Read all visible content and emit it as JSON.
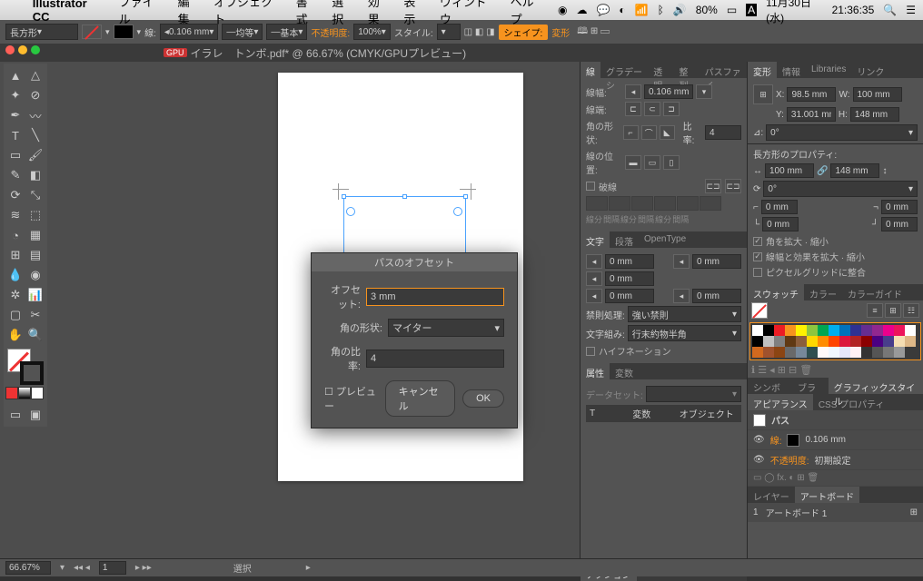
{
  "menubar": {
    "app": "Illustrator CC",
    "items": [
      "ファイル",
      "編集",
      "オブジェクト",
      "書式",
      "選択",
      "効果",
      "表示",
      "ウィンドウ",
      "ヘルプ"
    ],
    "battery": "80%",
    "date": "11月30日(水)",
    "time": "21:36:35"
  },
  "ctrlbar": {
    "mode": "長方形",
    "stroke_label": "線:",
    "stroke_val": "0.106 mm",
    "dash": "均等",
    "profile": "基本",
    "opacity_label": "不透明度:",
    "opacity_val": "100%",
    "style_label": "スタイル:",
    "shape_label": "シェイプ:",
    "transform_label": "変形"
  },
  "tab": {
    "title": "イラレ　トンボ.pdf* @ 66.67% (CMYK/GPUプレビュー)"
  },
  "dialog": {
    "title": "パスのオフセット",
    "offset_label": "オフセット:",
    "offset_val": "3 mm",
    "join_label": "角の形状:",
    "join_val": "マイター",
    "miter_label": "角の比率:",
    "miter_val": "4",
    "preview": "プレビュー",
    "cancel": "キャンセル",
    "ok": "OK"
  },
  "stroke_panel": {
    "tabs": [
      "線",
      "グラデーシ",
      "透明",
      "整列",
      "パスファイ"
    ],
    "width_label": "線幅:",
    "width_val": "0.106 mm",
    "cap_label": "線端:",
    "corner_label": "角の形状:",
    "ratio_label": "比率:",
    "ratio_val": "4",
    "align_label": "線の位置:",
    "dash_label": "破線",
    "dash_sub": [
      "線分",
      "間隔",
      "線分",
      "間隔",
      "線分",
      "間隔"
    ]
  },
  "char_panel": {
    "tabs": [
      "文字",
      "段落",
      "OpenType"
    ],
    "zero": "0 mm",
    "kinsoku_label": "禁則処理:",
    "kinsoku_val": "強い禁則",
    "moji_label": "文字組み:",
    "moji_val": "行末約物半角",
    "hyphen": "ハイフネーション"
  },
  "attr_panel": {
    "tabs": [
      "属性",
      "変数"
    ],
    "dataset": "データセット:",
    "var": "変数",
    "obj": "オブジェクト"
  },
  "actions_tab": "アクション",
  "transform_panel": {
    "tabs": [
      "変形",
      "情報",
      "Libraries",
      "リンク"
    ],
    "x": "X:",
    "x_val": "98.5 mm",
    "w": "W:",
    "w_val": "100 mm",
    "y": "Y:",
    "y_val": "31.001 mm",
    "h": "H:",
    "h_val": "148 mm",
    "angle": "0°",
    "rect_title": "長方形のプロパティ:",
    "rw": "100 mm",
    "rh": "148 mm",
    "r0": "0°",
    "c0": "0 mm",
    "chk1": "角を拡大 · 縮小",
    "chk2": "線幅と効果を拡大 · 縮小",
    "chk3": "ピクセルグリッドに整合"
  },
  "swatch_panel": {
    "tabs": [
      "スウォッチ",
      "カラー",
      "カラーガイド"
    ]
  },
  "sym_panel": {
    "tabs": [
      "シンボル",
      "ブラシ",
      "グラフィックスタイル"
    ]
  },
  "appear_panel": {
    "tabs": [
      "アピアランス",
      "CSS プロパティ"
    ],
    "path": "パス",
    "stroke": "線:",
    "stroke_val": "0.106 mm",
    "opacity": "不透明度:",
    "opacity_val": "初期設定"
  },
  "layer_panel": {
    "tabs": [
      "レイヤー",
      "アートボード"
    ],
    "num": "1",
    "name": "アートボード 1"
  },
  "statusbar": {
    "zoom": "66.67%",
    "artboard": "1",
    "sel": "選択"
  },
  "colors": {
    "swatch_row": [
      "#fff",
      "#000",
      "#ed1c24",
      "#f7931e",
      "#fff200",
      "#00a651",
      "#00aeef",
      "#2e3192",
      "#ec008c",
      "#8b5e3c",
      "#ffffff",
      "#000000",
      "#c0c0c0",
      "#808080"
    ]
  }
}
